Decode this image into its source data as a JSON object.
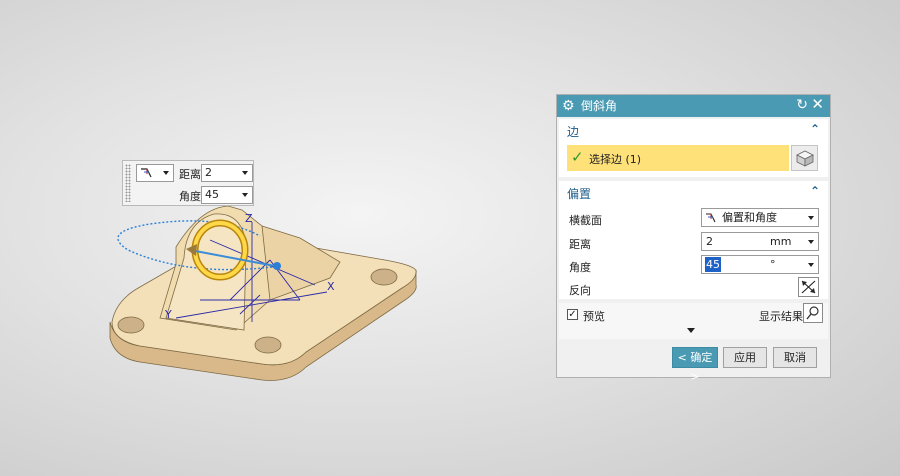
{
  "osi": {
    "distance_label": "距离",
    "distance_value": "2",
    "angle_label": "角度",
    "angle_value": "45"
  },
  "viewport": {
    "axis_z": "Z",
    "axis_y": "Y",
    "axis_x": "X"
  },
  "dialog": {
    "title": "倒斜角",
    "edge_group": {
      "title": "边",
      "select_label": "选择边 (1)"
    },
    "offset_group": {
      "title": "偏置",
      "cross_section_label": "横截面",
      "cross_section_value": "偏置和角度",
      "distance_label": "距离",
      "distance_value": "2",
      "distance_unit": "mm",
      "angle_label": "角度",
      "angle_value": "45",
      "angle_unit": "°",
      "reverse_label": "反向"
    },
    "preview_label": "预览",
    "preview_checked": true,
    "show_result_label": "显示结果",
    "ok_label": "< 确定 >",
    "apply_label": "应用",
    "cancel_label": "取消",
    "accent_color": "#4a9ab3",
    "selection_color": "#ffe17a"
  }
}
